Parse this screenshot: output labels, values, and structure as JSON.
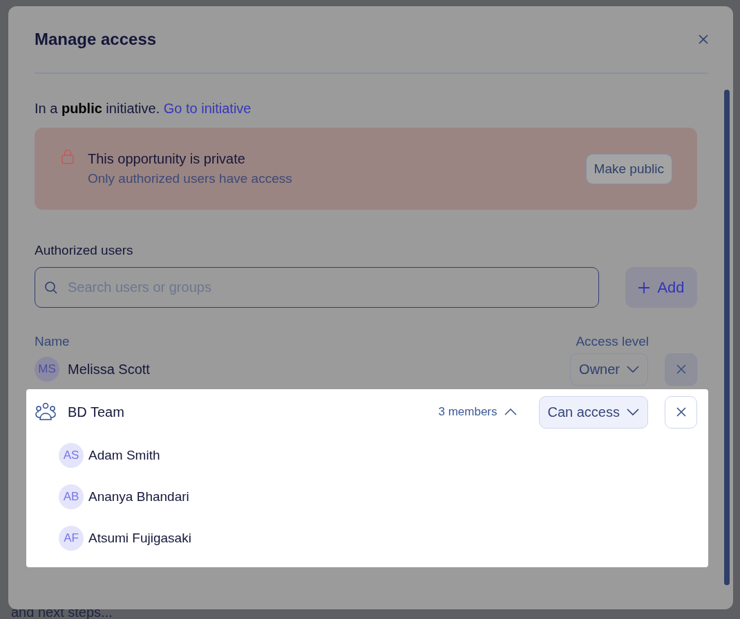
{
  "background": {
    "text": "and next steps..."
  },
  "dialog": {
    "title": "Manage access"
  },
  "visibility_note": {
    "text": "In a **public** initiative.",
    "link": "Go to initiative"
  },
  "alert": {
    "title": "This opportunity is private",
    "message": "Only authorized users have access",
    "button": "Make public"
  },
  "section_label": "Authorized users",
  "search": {
    "placeholder": "Search users or groups"
  },
  "add_button": "Add",
  "columns": [
    "Name",
    "Access level"
  ],
  "entries": [
    {
      "kind": "user",
      "initials": "MS",
      "name": "Melissa Scott",
      "access": "Owner",
      "highlighted": false
    },
    {
      "kind": "group",
      "name": "BD Team",
      "members_count": "3 members",
      "expanded": true,
      "access": "Can access",
      "highlighted": true,
      "children": [
        {
          "initials": "AS",
          "name": "Adam Smith"
        },
        {
          "initials": "AB",
          "name": "Ananya Bhandari"
        },
        {
          "initials": "AF",
          "name": "Atsumi Fujigasaki"
        }
      ]
    }
  ]
}
